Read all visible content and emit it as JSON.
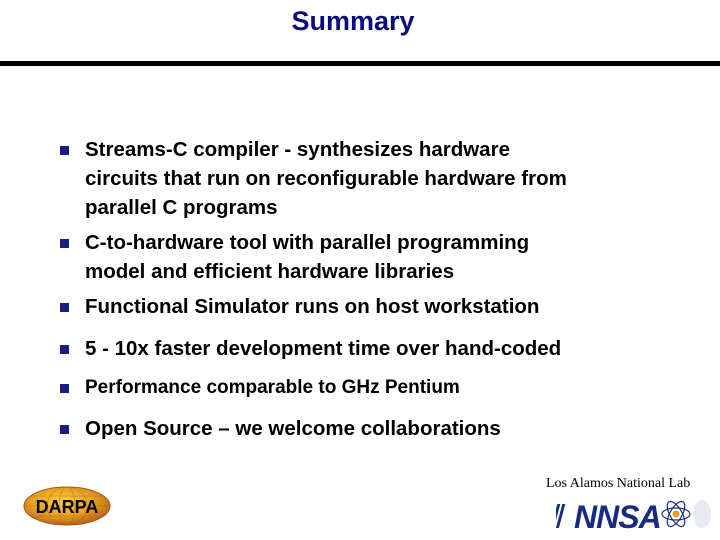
{
  "slide": {
    "title": "Summary",
    "bullets": [
      {
        "text": "Streams-C compiler - synthesizes hardware\ncircuits that run on reconfigurable hardware from\nparallel C programs"
      },
      {
        "text": "C-to-hardware tool with parallel programming\nmodel and efficient hardware libraries"
      },
      {
        "text": "Functional Simulator runs on host workstation"
      },
      {
        "text": "5 - 10x faster development time over hand-coded"
      },
      {
        "text": "Performance comparable to GHz Pentium"
      },
      {
        "text": "Open Source – we welcome collaborations"
      }
    ],
    "footer": {
      "darpa_label": "DARPA",
      "lab_name": "Los Alamos National Lab",
      "nnsa_label": "NNSA"
    },
    "colors": {
      "title": "#0b0b80",
      "bullet_marker": "#1b1b86",
      "rule": "#000000"
    }
  }
}
